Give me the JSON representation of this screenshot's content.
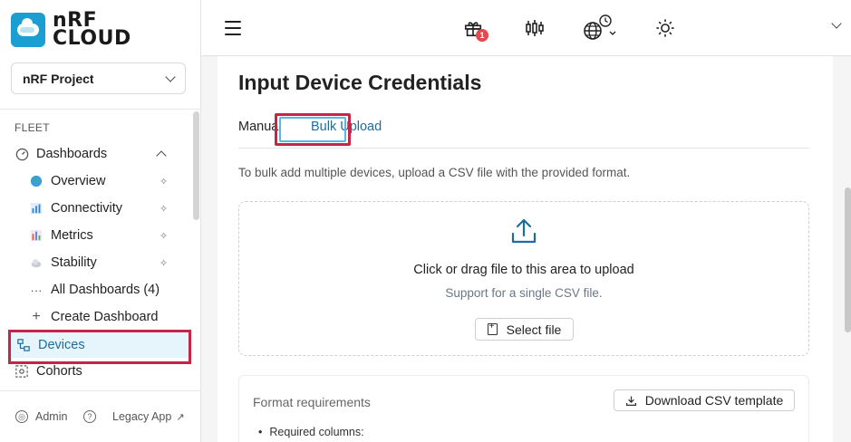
{
  "brand": {
    "line1": "nRF",
    "line2": "CLOUD"
  },
  "project": {
    "name": "nRF Project"
  },
  "sidebar": {
    "section": "FLEET",
    "items": [
      {
        "label": "Dashboards"
      },
      {
        "label": "Overview"
      },
      {
        "label": "Connectivity"
      },
      {
        "label": "Metrics"
      },
      {
        "label": "Stability"
      },
      {
        "label": "All Dashboards (4)"
      },
      {
        "label": "Create Dashboard"
      },
      {
        "label": "Devices"
      },
      {
        "label": "Cohorts"
      }
    ],
    "footer": {
      "admin": "Admin",
      "legacy": "Legacy App"
    }
  },
  "topbar": {
    "notification_count": "1"
  },
  "page": {
    "title": "Input Device Credentials",
    "tabs": [
      {
        "label": "Manual"
      },
      {
        "label": "Bulk Upload"
      }
    ],
    "description": "To bulk add multiple devices, upload a CSV file with the provided format.",
    "dropzone": {
      "title": "Click or drag file to this area to upload",
      "subtitle": "Support for a single CSV file.",
      "button": "Select file"
    },
    "format": {
      "title": "Format requirements",
      "download": "Download CSV template",
      "first_item": "Required columns:"
    }
  },
  "colors": {
    "accent": "#1a6fa0",
    "highlight": "#c4264a",
    "brand": "#1b9ed1"
  }
}
